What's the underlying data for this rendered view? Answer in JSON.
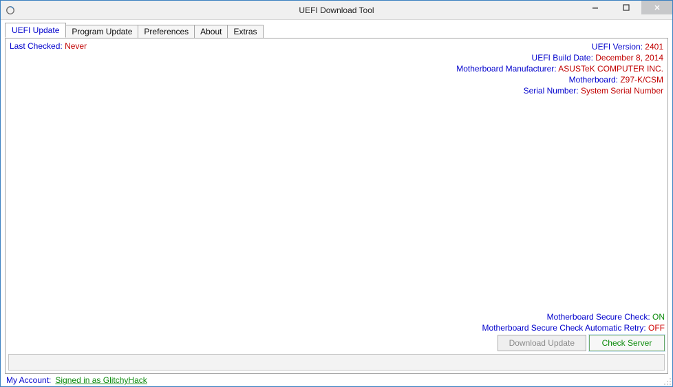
{
  "window": {
    "title": "UEFI Download Tool"
  },
  "tabs": [
    {
      "label": "UEFI Update",
      "active": true
    },
    {
      "label": "Program Update",
      "active": false
    },
    {
      "label": "Preferences",
      "active": false
    },
    {
      "label": "About",
      "active": false
    },
    {
      "label": "Extras",
      "active": false
    }
  ],
  "last_checked": {
    "label": "Last Checked:",
    "value": "Never"
  },
  "info": {
    "uefi_version": {
      "label": "UEFI Version:",
      "value": "2401"
    },
    "uefi_build_date": {
      "label": "UEFI Build Date:",
      "value": "December 8, 2014"
    },
    "mobo_manufacturer": {
      "label": "Motherboard Manufacturer:",
      "value": "ASUSTeK COMPUTER INC."
    },
    "motherboard": {
      "label": "Motherboard:",
      "value": "Z97-K/CSM"
    },
    "serial_number": {
      "label": "Serial Number:",
      "value": "System Serial Number"
    }
  },
  "secure": {
    "check": {
      "label": "Motherboard Secure Check:",
      "value": "ON"
    },
    "retry": {
      "label": "Motherboard Secure Check Automatic Retry:",
      "value": "OFF"
    }
  },
  "buttons": {
    "download_update": "Download Update",
    "check_server": "Check Server"
  },
  "footer": {
    "label": "My Account:",
    "signed_in": "Signed in as GlitchyHack"
  }
}
